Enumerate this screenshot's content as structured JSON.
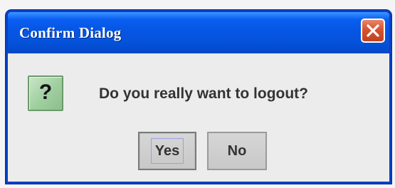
{
  "dialog": {
    "title": "Confirm Dialog",
    "close_icon": "close-icon",
    "icon": {
      "name": "question-icon",
      "glyph": "?"
    },
    "message": "Do you really want to logout?",
    "buttons": {
      "yes_label": "Yes",
      "no_label": "No"
    },
    "colors": {
      "titlebar": "#0757e6",
      "close_button": "#d6532f",
      "icon_bg": "#9fce9f",
      "body": "#ececec"
    }
  }
}
